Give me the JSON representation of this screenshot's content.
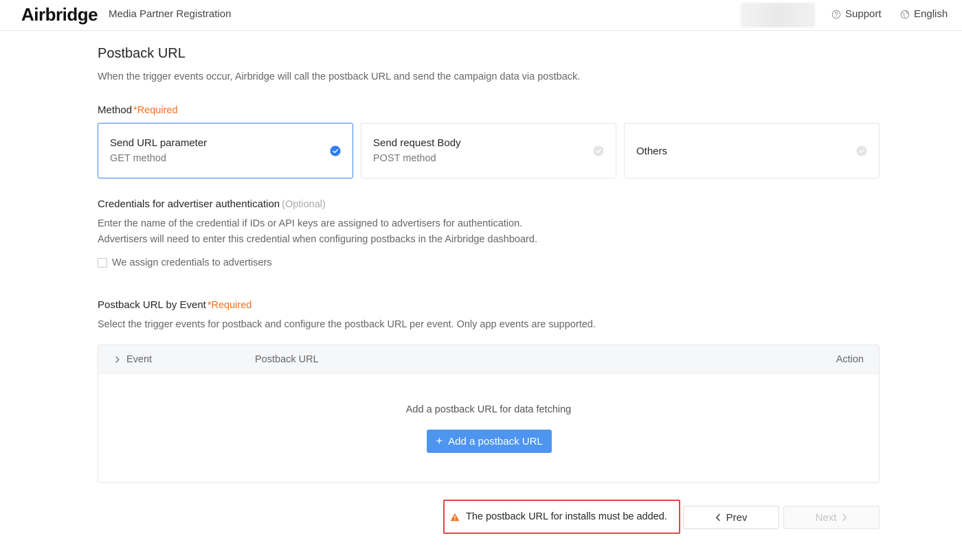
{
  "header": {
    "logo": "Airbridge",
    "page_name": "Media Partner Registration",
    "support_label": "Support",
    "language_label": "English"
  },
  "title": "Postback URL",
  "description": "When the trigger events occur, Airbridge will call the postback URL and send the campaign data via postback.",
  "method": {
    "label": "Method",
    "required": "*Required",
    "options": [
      {
        "title": "Send URL parameter",
        "subtitle": "GET method",
        "selected": true
      },
      {
        "title": "Send request Body",
        "subtitle": "POST method",
        "selected": false
      },
      {
        "title": "Others",
        "subtitle": "",
        "selected": false
      }
    ]
  },
  "credentials": {
    "label": "Credentials for advertiser authentication",
    "optional": "(Optional)",
    "desc_line1": "Enter the name of the credential if IDs or API keys are assigned to advertisers for authentication.",
    "desc_line2": "Advertisers will need to enter this credential when configuring postbacks in the Airbridge dashboard.",
    "checkbox_label": "We assign credentials to advertisers",
    "checked": false
  },
  "postback_by_event": {
    "label": "Postback URL by Event",
    "required": "*Required",
    "description": "Select the trigger events for postback and configure the postback URL per event. Only app events are supported.",
    "columns": {
      "event": "Event",
      "postback_url": "Postback URL",
      "action": "Action"
    },
    "empty_text": "Add a postback URL for data fetching",
    "add_button": "Add a postback URL"
  },
  "footer": {
    "warning": "The postback URL for installs must be added.",
    "prev": "Prev",
    "next": "Next"
  },
  "colors": {
    "accent": "#4e95f0",
    "selected_border": "#3d86e8",
    "required": "#f5701f",
    "warning_border": "#e04848",
    "warning_icon": "#f0772a"
  },
  "icons": [
    "help-circle-icon",
    "globe-icon",
    "check-circle-icon",
    "chevron-right-icon",
    "plus-icon",
    "warning-icon",
    "chevron-left-icon"
  ]
}
